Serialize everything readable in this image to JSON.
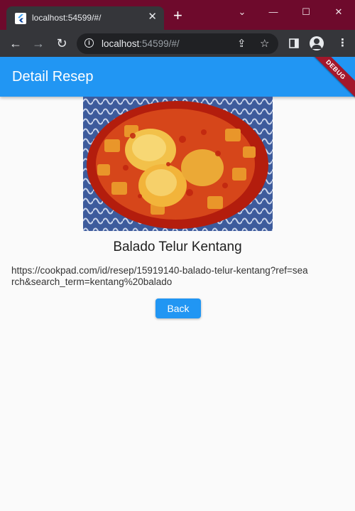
{
  "browser": {
    "tab_title": "localhost:54599/#/",
    "tab_close": "✕",
    "new_tab": "+",
    "url_host": "localhost",
    "url_rest": ":54599/#/",
    "controls": {
      "minimize": "—",
      "maximize": "☐",
      "close": "✕"
    },
    "chevron": "⌄"
  },
  "app": {
    "title": "Detail Resep",
    "debug_banner": "DEBUG",
    "recipe": {
      "name": "Balado Telur Kentang",
      "url": "https://cookpad.com/id/resep/15919140-balado-telur-kentang?ref=search&search_term=kentang%20balado"
    },
    "back_label": "Back"
  },
  "colors": {
    "appbar": "#2196f3",
    "button": "#2196f3",
    "window_frame": "#6e0a2c",
    "chrome_toolbar": "#35363a",
    "debug_banner": "#a3172b"
  }
}
